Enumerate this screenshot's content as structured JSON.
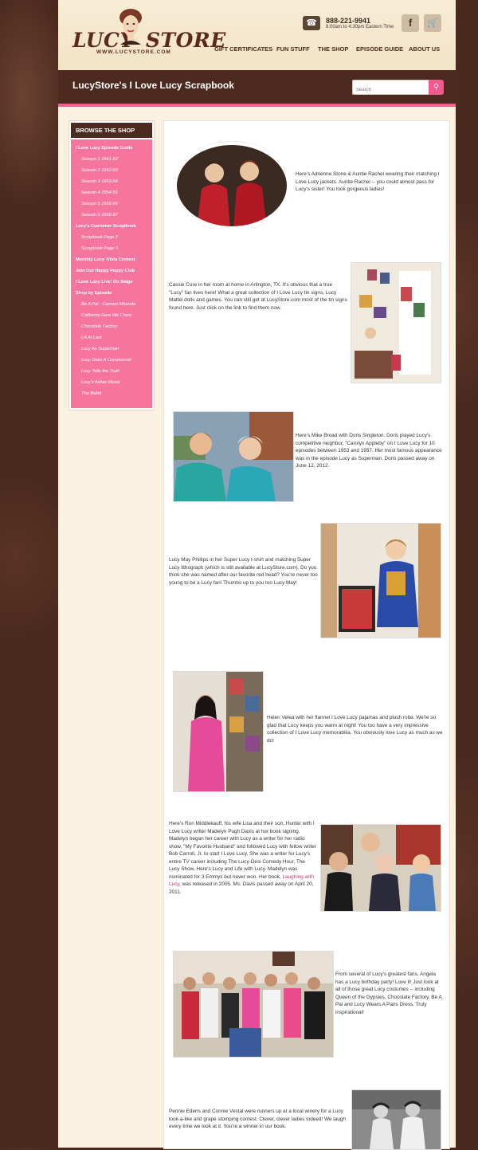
{
  "header": {
    "logo_left": "LUCY",
    "logo_right": "STORE",
    "logo_url": "WWW.LUCYSTORE.COM",
    "phone_icon": "phone-icon",
    "phone": "888-221-9941",
    "hours": "8:00am to 4:30pm Eastern Time",
    "facebook_icon": "f",
    "cart_icon": "🛒",
    "nav": [
      "GIFT CERTIFICATES",
      "FUN STUFF",
      "THE SHOP",
      "EPISODE GUIDE",
      "ABOUT US"
    ]
  },
  "band": {
    "title": "LucyStore's I Love Lucy Scrapbook",
    "search_placeholder": "Search",
    "search_icon": "⚲"
  },
  "sidebar": {
    "heading": "BROWSE THE SHOP",
    "items": [
      {
        "label": "I Love Lucy Episode Guide",
        "level": "top"
      },
      {
        "label": "Season 1 1951-52",
        "level": "sub"
      },
      {
        "label": "Season 2 1952-53",
        "level": "sub"
      },
      {
        "label": "Season 3 1953-54",
        "level": "sub"
      },
      {
        "label": "Season 4 1954-55",
        "level": "sub"
      },
      {
        "label": "Season 5 1955-56",
        "level": "sub"
      },
      {
        "label": "Season 6 1956-57",
        "level": "sub"
      },
      {
        "label": "Lucy's Customer Scrapbook",
        "level": "top"
      },
      {
        "label": "Scrapbook Page 2",
        "level": "sub"
      },
      {
        "label": "Scrapbook Page 3",
        "level": "sub"
      },
      {
        "label": "Monthly Lucy Trivia Contest",
        "level": "top"
      },
      {
        "label": "Join Our Happy Peppy Club",
        "level": "top"
      },
      {
        "label": "I Love Lucy Live! On Stage",
        "level": "top"
      },
      {
        "label": "Shop by Episode",
        "level": "top"
      },
      {
        "label": "Be A Pal - Carmen Miranda",
        "level": "sub"
      },
      {
        "label": "California Here We Come",
        "level": "sub"
      },
      {
        "label": "Chocolate Factory",
        "level": "sub"
      },
      {
        "label": "LA At Last",
        "level": "sub"
      },
      {
        "label": "Lucy As Superman",
        "level": "sub"
      },
      {
        "label": "Lucy Does A Commercial",
        "level": "sub"
      },
      {
        "label": "Lucy Tells the Truth",
        "level": "sub"
      },
      {
        "label": "Lucy's Italian Movie",
        "level": "sub"
      },
      {
        "label": "The Ballet",
        "level": "sub"
      }
    ]
  },
  "entries": [
    {
      "text": "Here's Adrienne Stone & Auntie Rachel wearing their matching I Love Lucy jackets.  Auntie Rachel -- you could almost pass for Lucy's sister!  You look gorgeous ladies!"
    },
    {
      "text": "Cassie Cure in her room at home in Arlington, TX.  It's obvious that a true \"Lucy\" fan lives here! What a great collection of I Love Lucy tin signs, Lucy Mattel dolls and games.  You can still get at LucyStore.com most of the tin signs found here.  Just click on the link to find them now."
    },
    {
      "text": "Here's Mike Broad with Doris Singleton.  Doris played Lucy's competitive neighbor, \"Carolyn Appleby\" on I Love Lucy for 10 episodes between 1953 and 1957.  Her most famous appearance was in the episode Lucy as Superman.  Doris passed away on June 12, 2012."
    },
    {
      "text": "Lucy May Phillips in her Super Lucy t-shirt and matching Super Lucy lithograph (which is still available at LucyStore.com).  Do you think she was named after our favorite red head?  You're never too young to be a Lucy fan! Thumbs up to you too Lucy May!"
    },
    {
      "text": "Helen Velea with her flannel I Love Lucy pajamas and plush robe.  We're so glad that Lucy keeps you warm at night!  You too have a very impressive collection of I Love Lucy memorabilia.  You obviously love Lucy as much as we do!"
    },
    {
      "text_before": "Here's Ron Middlekauff, his wife Lisa and their son, Hunter with I Love Lucy writer Madelyn Pugh Davis at her book signing.  Madelyn began her career with Lucy as a writer for her radio show, \"My Favorite Husband\" and followed Lucy with fellow writer Bob Carroll, Jr. to start I Love Lucy.  She was a writer for Lucy's entire TV career including The Lucy-Desi Comedy Hour, The Lucy Show, Here's Lucy and Life with Lucy.  Madelyn was nominated for 3 Emmys but never won.  Her book, ",
      "link": "Laughing with Lucy",
      "text_after": ", was released in 2005.  Ms. Davis passed away on April 20, 2011."
    },
    {
      "text": "From several of Lucy's greatest fans, Angela has a Lucy birthday party!  Love it!  Just look at all of those great Lucy costumes -- including Queen of the Gypsies, Chocolate Factory, Be A Pal and Lucy Wears A Paris Dress.  Truly inspirational!"
    },
    {
      "text": "Pennie Edens and Connie Vestal were runners up at a local winery for a Lucy look-a-like and grape stomping contest.  Clever, clever ladies indeed!  We laugh every time we look at it.  You're a winner in our book."
    }
  ]
}
